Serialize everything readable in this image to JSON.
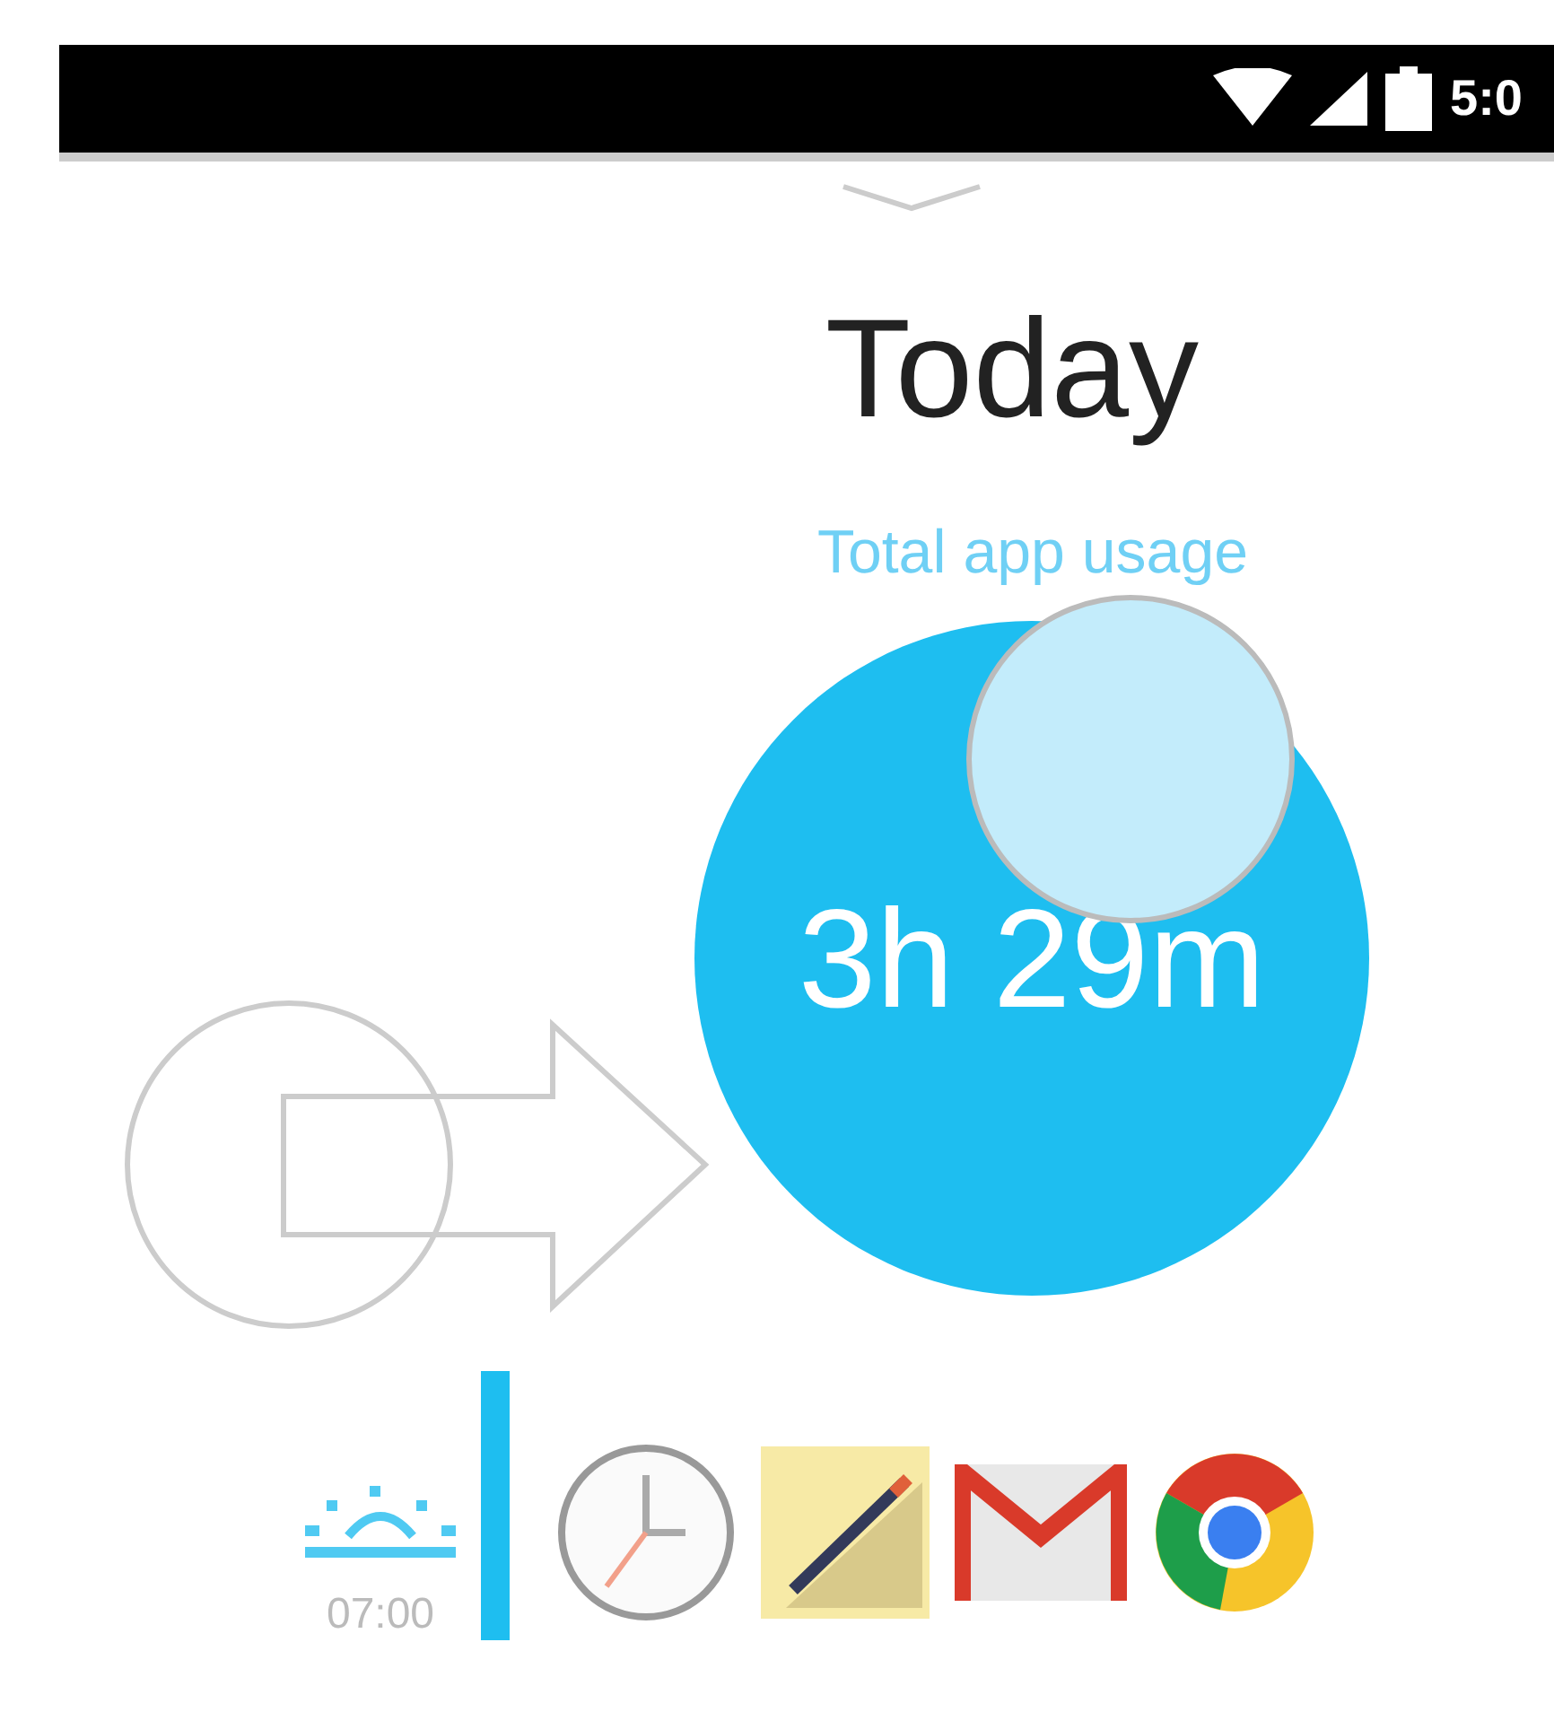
{
  "status_bar": {
    "time": "5:0"
  },
  "header": {
    "title": "Today"
  },
  "usage": {
    "label": "Total app usage",
    "total": "3h 29m"
  },
  "timeline": {
    "time": "07:00"
  }
}
